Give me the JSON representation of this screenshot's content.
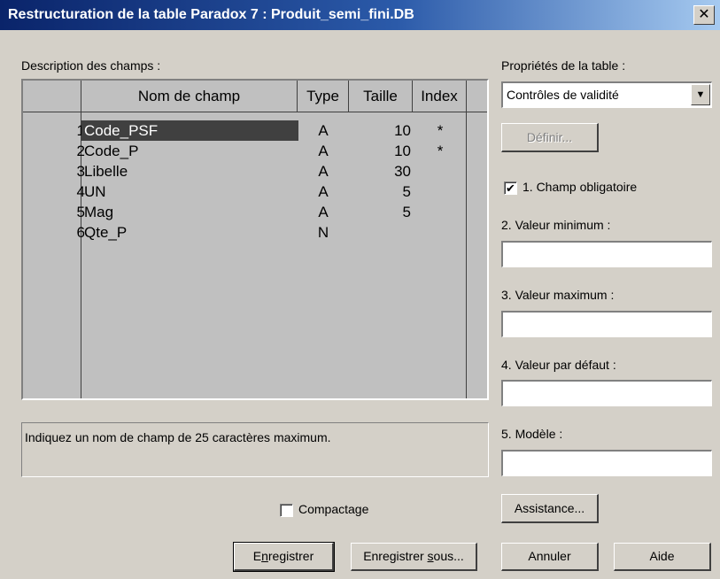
{
  "window": {
    "title": "Restructuration de la table Paradox 7 : Produit_semi_fini.DB",
    "close_glyph": "✕"
  },
  "fields_section": {
    "label": "Description des champs :",
    "columns": [
      "Nom de champ",
      "Type",
      "Taille",
      "Index"
    ],
    "rows": [
      {
        "num": "1",
        "name": "Code_PSF",
        "type": "A",
        "size": "10",
        "index": "*"
      },
      {
        "num": "2",
        "name": "Code_P",
        "type": "A",
        "size": "10",
        "index": "*"
      },
      {
        "num": "3",
        "name": "Libelle",
        "type": "A",
        "size": "30",
        "index": ""
      },
      {
        "num": "4",
        "name": "UN",
        "type": "A",
        "size": "5",
        "index": ""
      },
      {
        "num": "5",
        "name": "Mag",
        "type": "A",
        "size": "5",
        "index": ""
      },
      {
        "num": "6",
        "name": "Qte_P",
        "type": "N",
        "size": "",
        "index": ""
      }
    ],
    "selected_row": 1
  },
  "hint_text": "Indiquez un nom de champ de 25 caractères maximum.",
  "compactage": {
    "label": "Compactage",
    "checked": false
  },
  "table_properties": {
    "label": "Propriétés de la table :",
    "selected": "Contrôles de validité",
    "define_button": "Définir...",
    "required_checkbox": {
      "label": "1. Champ obligatoire",
      "checked": true
    },
    "min_label": "2. Valeur minimum :",
    "min_value": "",
    "max_label": "3. Valeur maximum :",
    "max_value": "",
    "default_label": "4. Valeur par défaut :",
    "default_value": "",
    "model_label": "5. Modèle :",
    "model_value": "",
    "assist_button": "Assistance..."
  },
  "buttons": {
    "save_pre": "E",
    "save_mnemonic": "n",
    "save_post": "registrer",
    "save_as_pre": "Enregistrer ",
    "save_as_mnemonic": "s",
    "save_as_post": "ous...",
    "cancel": "Annuler",
    "help": "Aide"
  },
  "icons": {
    "check_glyph": "✔",
    "dropdown_glyph": "▼"
  }
}
